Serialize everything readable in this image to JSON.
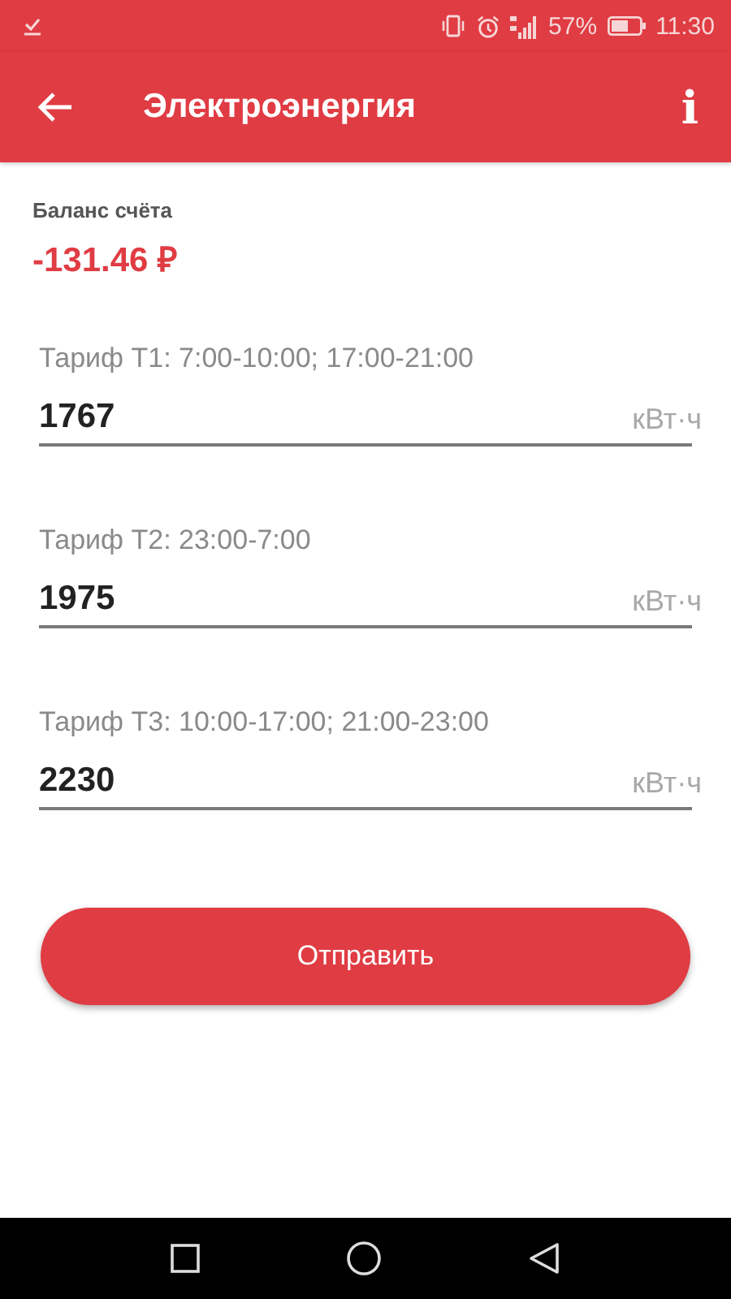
{
  "status_bar": {
    "battery_percent": "57%",
    "time": "11:30"
  },
  "toolbar": {
    "title": "Электроэнергия",
    "info": "i"
  },
  "balance": {
    "label": "Баланс счёта",
    "amount": "-131.46 ₽"
  },
  "tariffs": [
    {
      "label": "Тариф Т1: 7:00-10:00; 17:00-21:00",
      "value": "1767",
      "unit": "кВт·ч"
    },
    {
      "label": "Тариф Т2: 23:00-7:00",
      "value": "1975",
      "unit": "кВт·ч"
    },
    {
      "label": "Тариф Т3: 10:00-17:00; 21:00-23:00",
      "value": "2230",
      "unit": "кВт·ч"
    }
  ],
  "submit_button": "Отправить"
}
